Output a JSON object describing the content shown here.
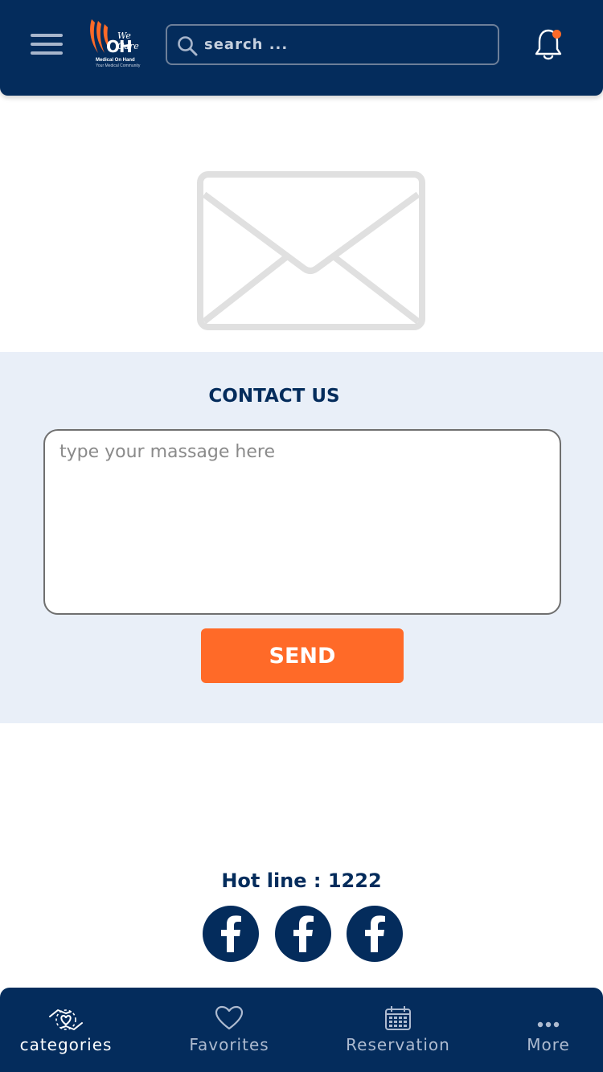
{
  "header": {
    "logo": {
      "tagline": "We Care",
      "mark": "OH",
      "name": "Medical On Hand",
      "subtitle": "Your Medical Community"
    },
    "search_placeholder": "search ...",
    "icons": {
      "menu": "hamburger-menu-icon",
      "search": "search-icon",
      "notifications": "bell-icon",
      "notification_dot_color": "#ff6a28"
    }
  },
  "hero": {
    "icon": "envelope-icon"
  },
  "contact": {
    "title": "CONTACT US",
    "message_placeholder": "type your massage here",
    "send_label": "SEND"
  },
  "footer": {
    "hotline": "Hot line : 1222",
    "socials": [
      "facebook-icon",
      "facebook-icon",
      "facebook-icon"
    ]
  },
  "bottom_nav": {
    "items": [
      {
        "label": "categories",
        "icon": "care-hands-icon",
        "active": true
      },
      {
        "label": "Favorites",
        "icon": "heart-icon",
        "active": false
      },
      {
        "label": "Reservation",
        "icon": "calendar-icon",
        "active": false
      },
      {
        "label": "More",
        "icon": "more-dots-icon",
        "active": false
      }
    ]
  },
  "colors": {
    "primary": "#042c5c",
    "accent": "#ff6a28",
    "section_bg": "#e9eff8"
  }
}
